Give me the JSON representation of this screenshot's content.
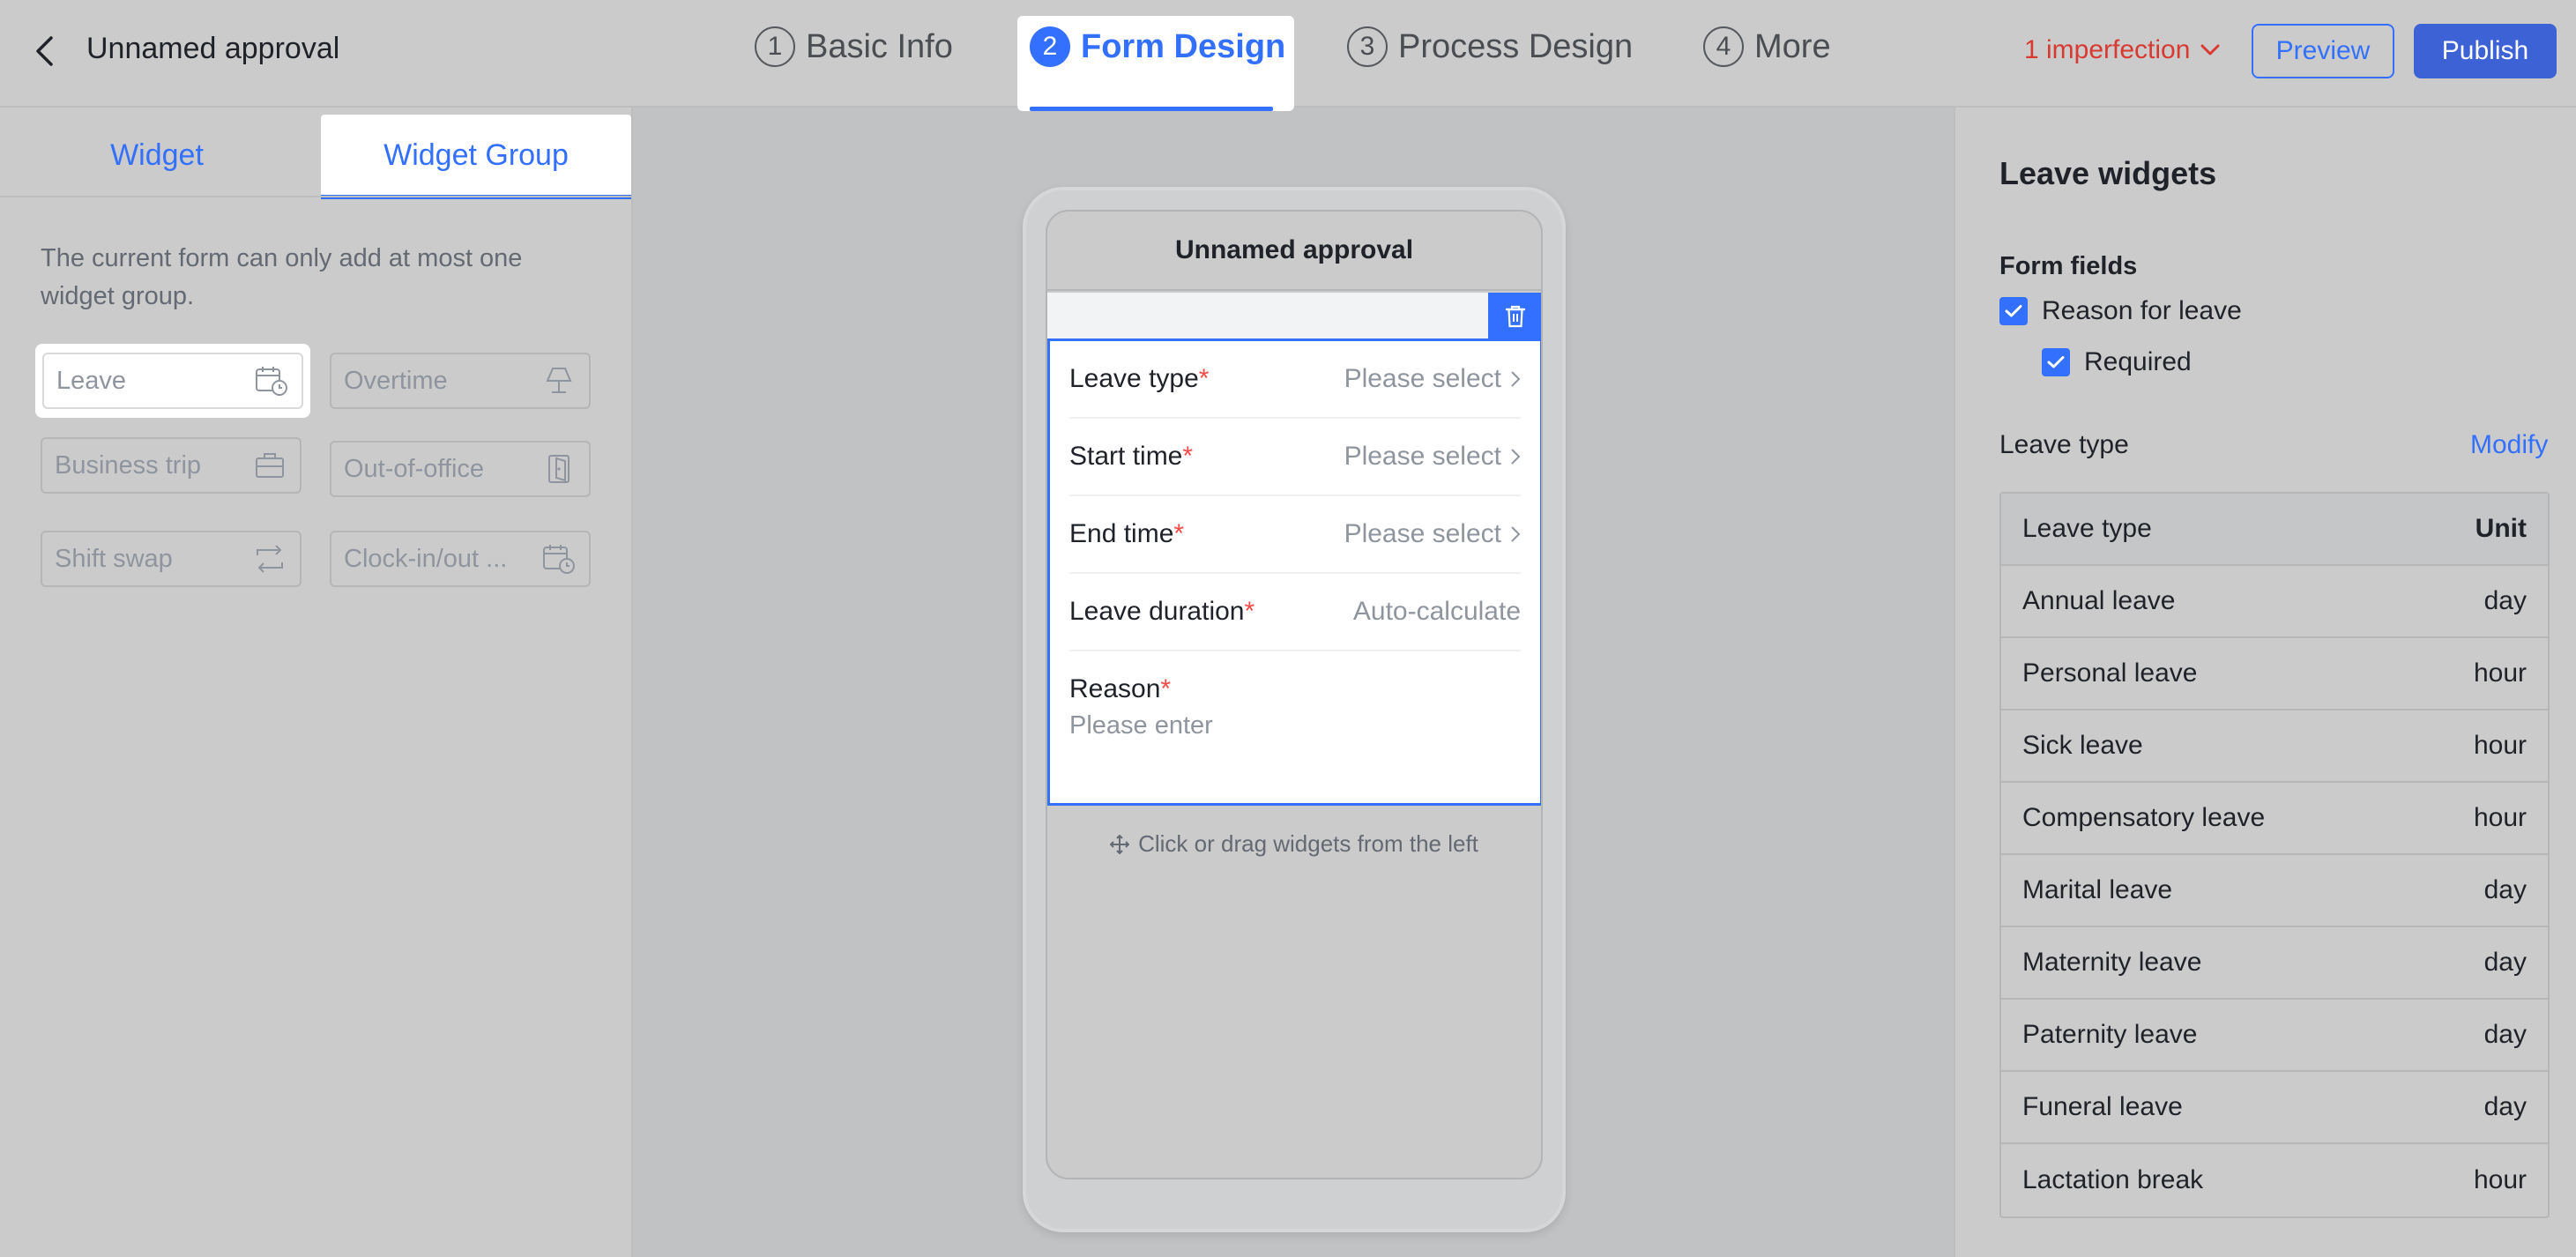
{
  "header": {
    "title": "Unnamed approval",
    "steps": [
      {
        "num": "1",
        "label": "Basic Info"
      },
      {
        "num": "2",
        "label": "Form Design"
      },
      {
        "num": "3",
        "label": "Process Design"
      },
      {
        "num": "4",
        "label": "More"
      }
    ],
    "imperfection": "1 imperfection",
    "preview": "Preview",
    "publish": "Publish"
  },
  "left": {
    "tabs": [
      "Widget",
      "Widget Group"
    ],
    "hint": "The current form can only add at most one widget group.",
    "groups": [
      {
        "label": "Leave",
        "icon": "calendar-clock-icon"
      },
      {
        "label": "Overtime",
        "icon": "lamp-icon"
      },
      {
        "label": "Business trip",
        "icon": "briefcase-icon"
      },
      {
        "label": "Out-of-office",
        "icon": "door-icon"
      },
      {
        "label": "Shift swap",
        "icon": "swap-icon"
      },
      {
        "label": "Clock-in/out ...",
        "icon": "calendar-clock-icon"
      }
    ]
  },
  "canvas": {
    "title": "Unnamed approval",
    "fields": [
      {
        "label": "Leave type",
        "value": "Please select"
      },
      {
        "label": "Start time",
        "value": "Please select"
      },
      {
        "label": "End time",
        "value": "Please select"
      },
      {
        "label": "Leave duration",
        "value": "Auto-calculate"
      }
    ],
    "reason_label": "Reason",
    "reason_placeholder": "Please enter",
    "required_mark": "*",
    "drag_hint": "Click or drag widgets from the left"
  },
  "right": {
    "title": "Leave widgets",
    "form_fields": "Form fields",
    "reason_checkbox": "Reason for leave",
    "required_checkbox": "Required",
    "leave_type_label": "Leave type",
    "modify": "Modify",
    "table_header": {
      "name": "Leave type",
      "unit": "Unit"
    },
    "table_rows": [
      {
        "name": "Annual leave",
        "unit": "day"
      },
      {
        "name": "Personal leave",
        "unit": "hour"
      },
      {
        "name": "Sick leave",
        "unit": "hour"
      },
      {
        "name": "Compensatory leave",
        "unit": "hour"
      },
      {
        "name": "Marital leave",
        "unit": "day"
      },
      {
        "name": "Maternity leave",
        "unit": "day"
      },
      {
        "name": "Paternity leave",
        "unit": "day"
      },
      {
        "name": "Funeral leave",
        "unit": "day"
      },
      {
        "name": "Lactation break",
        "unit": "hour"
      }
    ]
  },
  "colors": {
    "accent": "#3370ff",
    "error": "#d83931",
    "publish_bg": "#3d62d6"
  }
}
